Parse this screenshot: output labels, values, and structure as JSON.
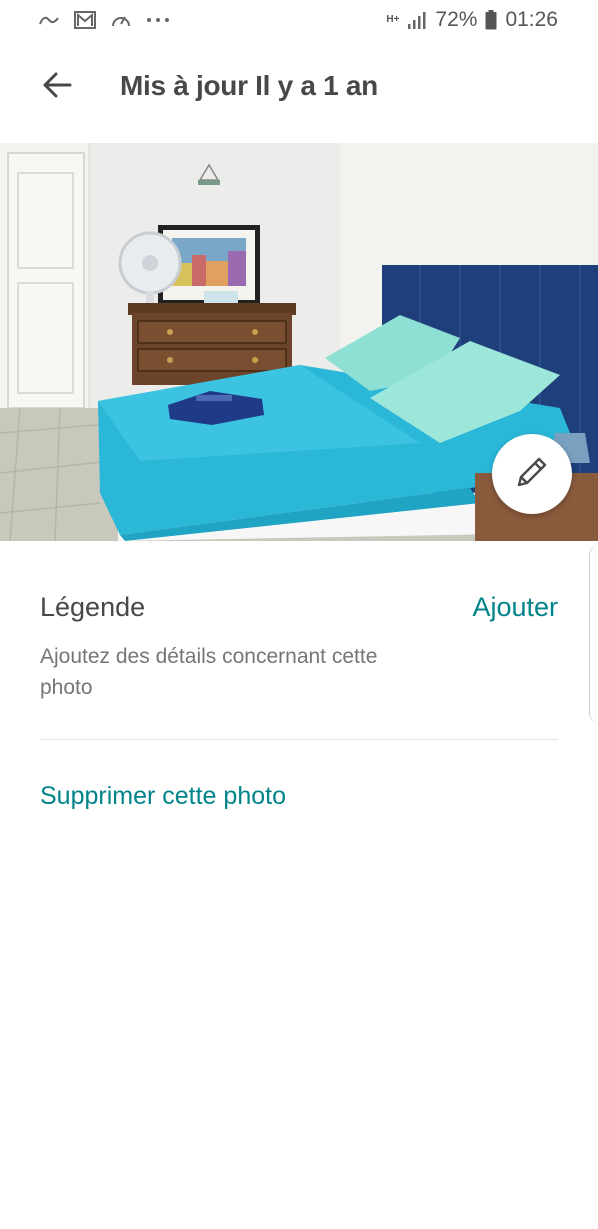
{
  "status_bar": {
    "network_type": "H+",
    "battery_percent": "72%",
    "time": "01:26",
    "icons": [
      "airbnb-icon",
      "gmail-icon",
      "speedometer-icon",
      "more-dots-icon",
      "signal-icon",
      "battery-icon"
    ]
  },
  "header": {
    "back_icon": "arrow-left-icon",
    "title": "Mis à jour Il y a 1 an"
  },
  "photo": {
    "edit_icon": "pencil-icon"
  },
  "caption": {
    "label": "Légende",
    "add_label": "Ajouter",
    "hint": "Ajoutez des détails concernant cette photo"
  },
  "actions": {
    "delete_label": "Supprimer cette photo"
  },
  "colors": {
    "accent": "#008489",
    "text_primary": "#484848",
    "text_secondary": "#767676",
    "divider": "#e4e4e4"
  }
}
